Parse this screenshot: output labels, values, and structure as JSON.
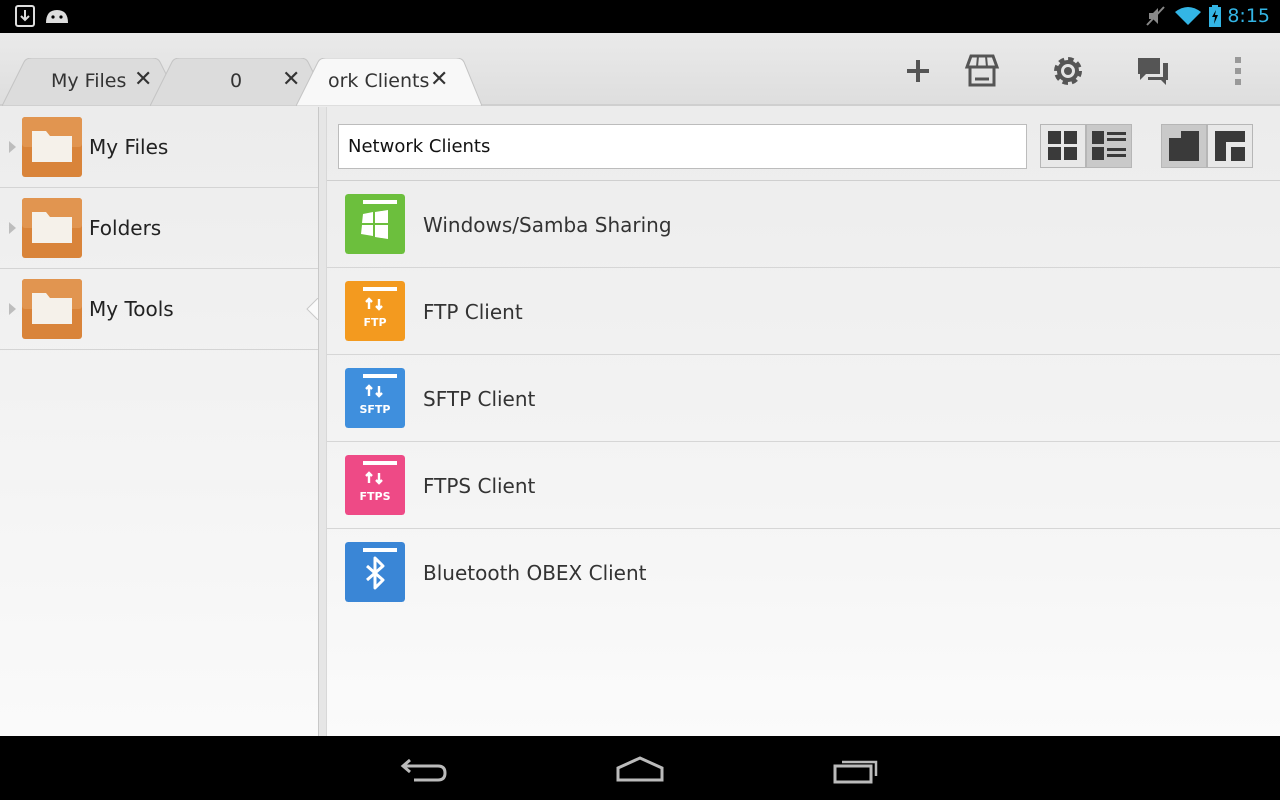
{
  "status": {
    "time": "8:15"
  },
  "tabs": [
    {
      "label": "My Files",
      "close": "✕"
    },
    {
      "label": "0",
      "close": "✕"
    },
    {
      "label": "ork Clients",
      "close": "✕"
    }
  ],
  "sidebar": {
    "items": [
      {
        "label": "My Files"
      },
      {
        "label": "Folders"
      },
      {
        "label": "My Tools"
      }
    ]
  },
  "main": {
    "path": "Network Clients",
    "items": [
      {
        "label": "Windows/Samba Sharing",
        "color": "#6cbf3d",
        "icon": "windows-logo"
      },
      {
        "label": "FTP Client",
        "color": "#f39a1f",
        "icon_text": "FTP"
      },
      {
        "label": "SFTP Client",
        "color": "#3f8fdd",
        "icon_text": "SFTP"
      },
      {
        "label": "FTPS Client",
        "color": "#ee4a86",
        "icon_text": "FTPS"
      },
      {
        "label": "Bluetooth OBEX Client",
        "color": "#3a86d6",
        "icon": "bluetooth"
      }
    ]
  },
  "colors": {
    "accent": "#33b5e5",
    "folder": "#d9843a"
  }
}
